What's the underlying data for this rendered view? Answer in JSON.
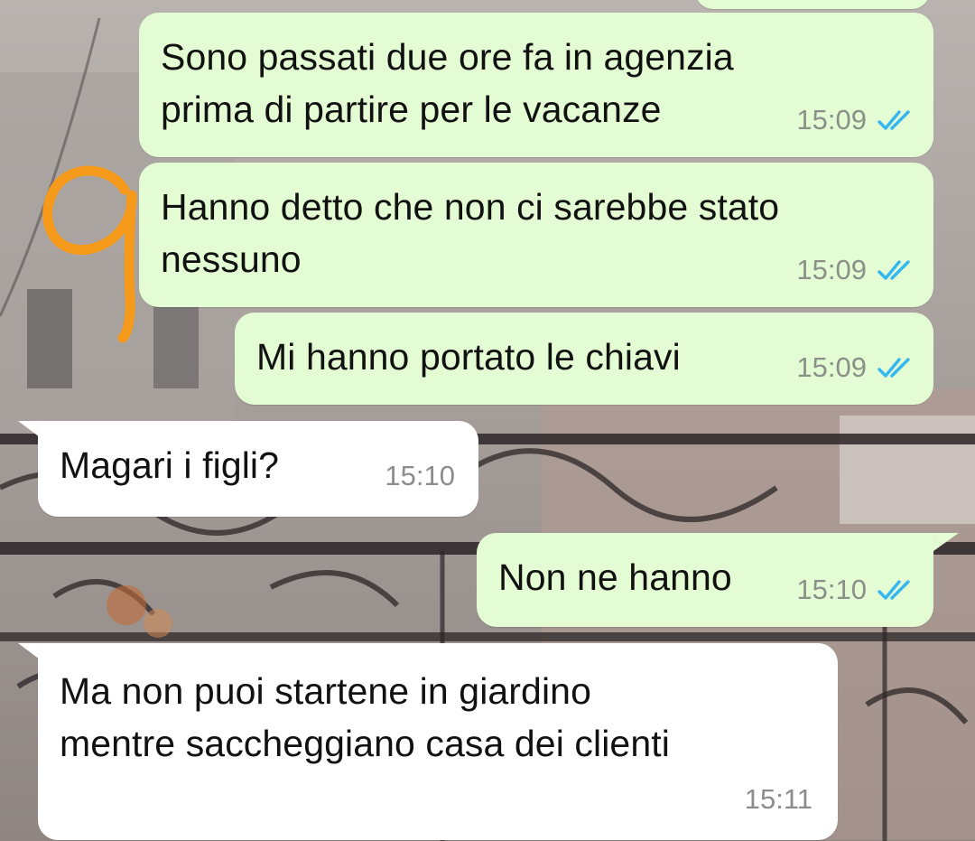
{
  "colors": {
    "outgoing_bubble": "#e3fcd3",
    "incoming_bubble": "#ffffff",
    "read_ticks": "#34b7f1",
    "timestamp": "#8a9189",
    "annotation": "#f59a1a"
  },
  "annotation": {
    "icon": "handwritten-digit-9-icon"
  },
  "messages": [
    {
      "direction": "outgoing",
      "lines": [
        "Sono passati due ore fa in agenzia",
        "prima di partire per le vacanze"
      ],
      "time": "15:09",
      "status": "read",
      "status_icon": "double-check-icon"
    },
    {
      "direction": "outgoing",
      "lines": [
        "Hanno detto che non ci sarebbe stato",
        "nessuno"
      ],
      "time": "15:09",
      "status": "read",
      "status_icon": "double-check-icon"
    },
    {
      "direction": "outgoing",
      "lines": [
        "Mi hanno portato le chiavi"
      ],
      "time": "15:09",
      "status": "read",
      "status_icon": "double-check-icon"
    },
    {
      "direction": "incoming",
      "lines": [
        "Magari i figli?"
      ],
      "time": "15:10"
    },
    {
      "direction": "outgoing",
      "lines": [
        "Non ne hanno"
      ],
      "time": "15:10",
      "status": "read",
      "status_icon": "double-check-icon"
    },
    {
      "direction": "incoming",
      "lines": [
        "Ma non puoi startene in giardino",
        "mentre saccheggiano casa dei clienti"
      ],
      "time": "15:11"
    }
  ]
}
